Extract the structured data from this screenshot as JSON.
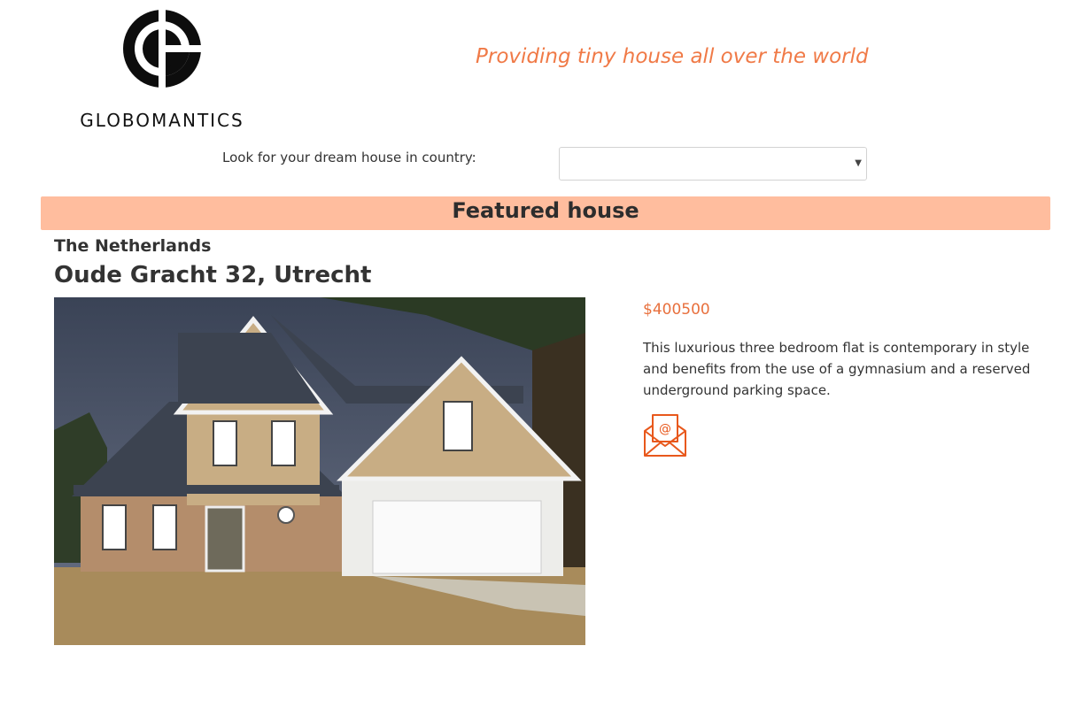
{
  "brand": {
    "name": "GLOBOMANTICS",
    "logo_icon": "globomantics-g-logo"
  },
  "header": {
    "tagline": "Providing tiny house all over the world"
  },
  "search": {
    "label": "Look for your dream house in country:",
    "selected": "",
    "caret_icon": "dropdown-caret-icon"
  },
  "featured": {
    "heading": "Featured house",
    "country": "The Netherlands",
    "address": "Oude Gracht 32, Utrecht",
    "price": "$400500",
    "description": "This luxurious three bedroom flat is contemporary in style and benefits from the use of a gymnasium and a reserved underground parking space.",
    "contact_icon": "envelope-at-icon"
  },
  "colors": {
    "accent": "#f07a47",
    "banner": "#ffbd9e",
    "price": "#e8703d"
  }
}
